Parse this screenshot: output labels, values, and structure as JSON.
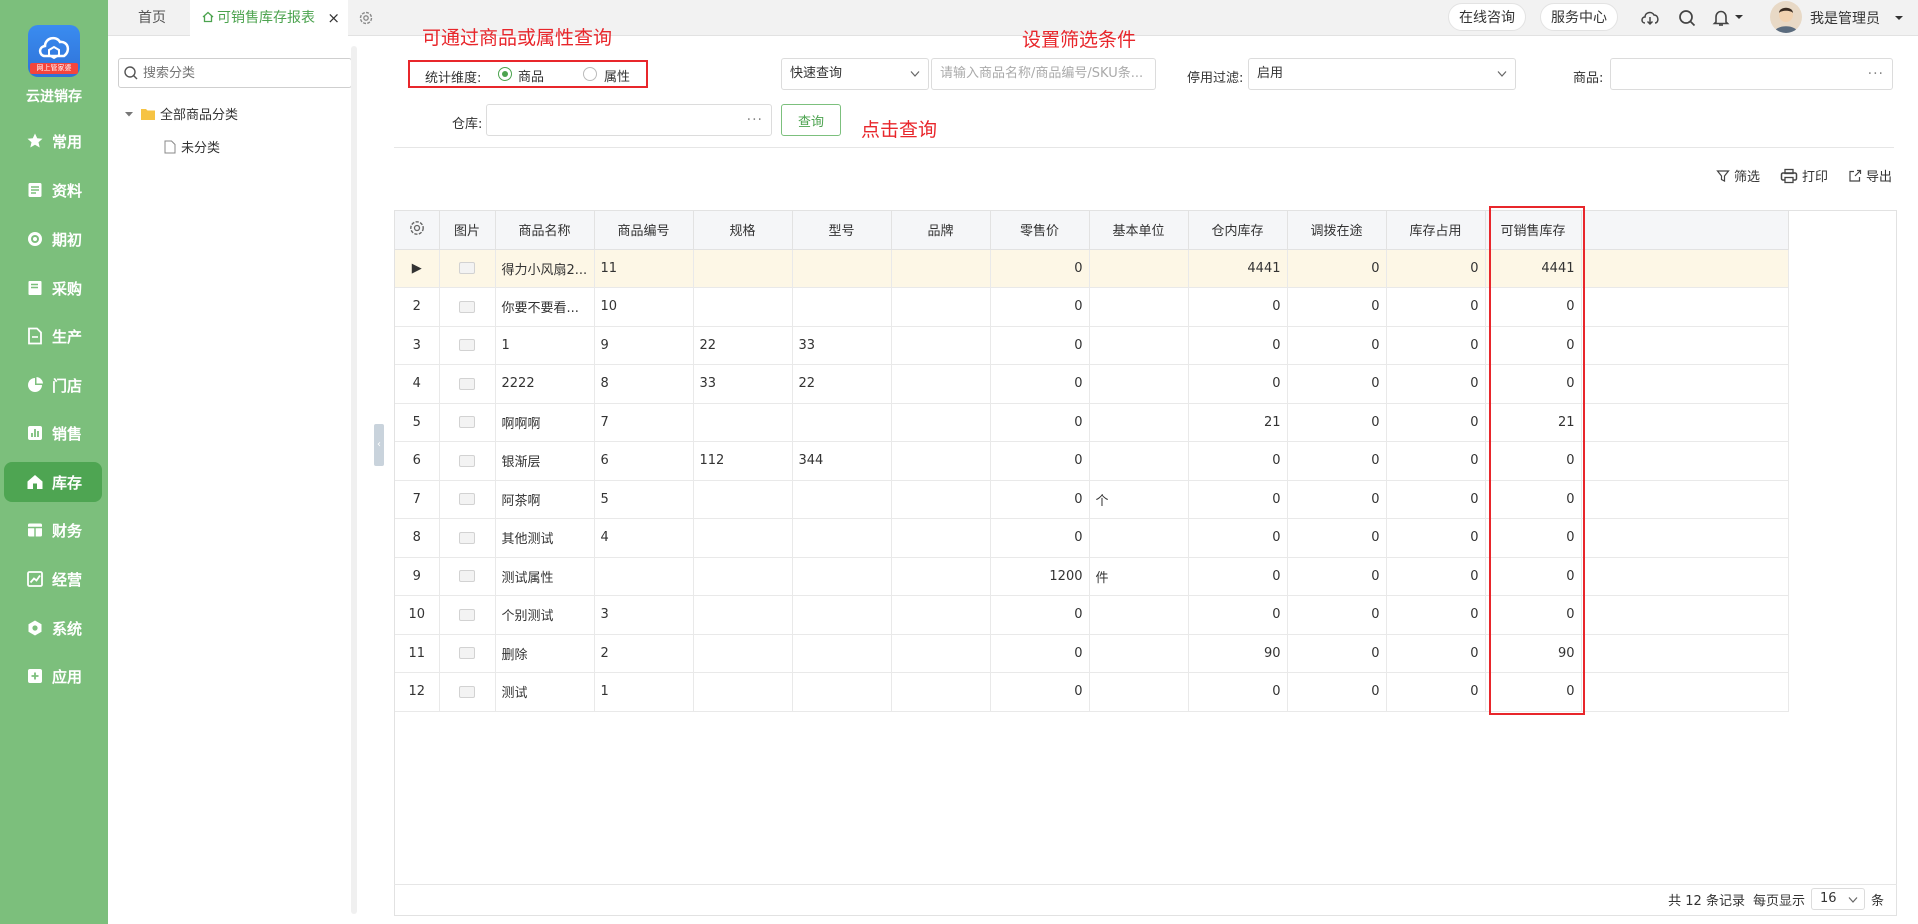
{
  "app": {
    "name": "云进销存",
    "logo_tag": "网上管家婆"
  },
  "nav": [
    {
      "label": "常用",
      "icon": "star-icon"
    },
    {
      "label": "资料",
      "icon": "document-icon"
    },
    {
      "label": "期初",
      "icon": "target-icon"
    },
    {
      "label": "采购",
      "icon": "book-icon"
    },
    {
      "label": "生产",
      "icon": "file-icon"
    },
    {
      "label": "门店",
      "icon": "pie-chart-icon"
    },
    {
      "label": "销售",
      "icon": "bar-chart-icon"
    },
    {
      "label": "库存",
      "icon": "house-icon",
      "active": true
    },
    {
      "label": "财务",
      "icon": "ledger-icon"
    },
    {
      "label": "经营",
      "icon": "trend-icon"
    },
    {
      "label": "系统",
      "icon": "hexagon-icon"
    },
    {
      "label": "应用",
      "icon": "plus-square-icon"
    }
  ],
  "tabs": {
    "home": "首页",
    "current": "可销售库存报表",
    "close": "×"
  },
  "topbar": {
    "consult": "在线咨询",
    "service": "服务中心",
    "user": "我是管理员"
  },
  "category": {
    "search_placeholder": "搜索分类",
    "root": "全部商品分类",
    "child": "未分类"
  },
  "filters": {
    "dimension_label": "统计维度:",
    "dim_product": "商品",
    "dim_attribute": "属性",
    "quick_select": "快速查询",
    "quick_placeholder": "请输入商品名称/商品编号/SKU条...",
    "disable_label": "停用过滤:",
    "disable_value": "启用",
    "product_label": "商品:",
    "warehouse_label": "仓库:",
    "query_button": "查询",
    "dots": "···"
  },
  "annotations": {
    "dimension": "可通过商品或属性查询",
    "conditions": "设置筛选条件",
    "click_query": "点击查询"
  },
  "toolbar": {
    "filter": "筛选",
    "print": "打印",
    "export": "导出"
  },
  "table": {
    "columns": [
      "图片",
      "商品名称",
      "商品编号",
      "规格",
      "型号",
      "品牌",
      "零售价",
      "基本单位",
      "仓内库存",
      "调拨在途",
      "库存占用",
      "可销售库存"
    ],
    "rows": [
      {
        "idx": "▶",
        "name": "得力小风扇2...",
        "code": "11",
        "spec": "",
        "model": "",
        "brand": "",
        "price": "0",
        "unit": "",
        "stock": "4441",
        "transit": "0",
        "occupied": "0",
        "available": "4441"
      },
      {
        "idx": "2",
        "name": "你要不要看...",
        "code": "10",
        "spec": "",
        "model": "",
        "brand": "",
        "price": "0",
        "unit": "",
        "stock": "0",
        "transit": "0",
        "occupied": "0",
        "available": "0"
      },
      {
        "idx": "3",
        "name": "1",
        "code": "9",
        "spec": "22",
        "model": "33",
        "brand": "",
        "price": "0",
        "unit": "",
        "stock": "0",
        "transit": "0",
        "occupied": "0",
        "available": "0"
      },
      {
        "idx": "4",
        "name": "2222",
        "code": "8",
        "spec": "33",
        "model": "22",
        "brand": "",
        "price": "0",
        "unit": "",
        "stock": "0",
        "transit": "0",
        "occupied": "0",
        "available": "0"
      },
      {
        "idx": "5",
        "name": "啊啊啊",
        "code": "7",
        "spec": "",
        "model": "",
        "brand": "",
        "price": "0",
        "unit": "",
        "stock": "21",
        "transit": "0",
        "occupied": "0",
        "available": "21"
      },
      {
        "idx": "6",
        "name": "银渐层",
        "code": "6",
        "spec": "112",
        "model": "344",
        "brand": "",
        "price": "0",
        "unit": "",
        "stock": "0",
        "transit": "0",
        "occupied": "0",
        "available": "0"
      },
      {
        "idx": "7",
        "name": "阿茶啊",
        "code": "5",
        "spec": "",
        "model": "",
        "brand": "",
        "price": "0",
        "unit": "个",
        "stock": "0",
        "transit": "0",
        "occupied": "0",
        "available": "0"
      },
      {
        "idx": "8",
        "name": "其他测试",
        "code": "4",
        "spec": "",
        "model": "",
        "brand": "",
        "price": "0",
        "unit": "",
        "stock": "0",
        "transit": "0",
        "occupied": "0",
        "available": "0"
      },
      {
        "idx": "9",
        "name": "测试属性",
        "code": "",
        "spec": "",
        "model": "",
        "brand": "",
        "price": "1200",
        "unit": "件",
        "stock": "0",
        "transit": "0",
        "occupied": "0",
        "available": "0"
      },
      {
        "idx": "10",
        "name": "个别测试",
        "code": "3",
        "spec": "",
        "model": "",
        "brand": "",
        "price": "0",
        "unit": "",
        "stock": "0",
        "transit": "0",
        "occupied": "0",
        "available": "0"
      },
      {
        "idx": "11",
        "name": "删除",
        "code": "2",
        "spec": "",
        "model": "",
        "brand": "",
        "price": "0",
        "unit": "",
        "stock": "90",
        "transit": "0",
        "occupied": "0",
        "available": "90"
      },
      {
        "idx": "12",
        "name": "测试",
        "code": "1",
        "spec": "",
        "model": "",
        "brand": "",
        "price": "0",
        "unit": "",
        "stock": "0",
        "transit": "0",
        "occupied": "0",
        "available": "0"
      }
    ]
  },
  "pager": {
    "total": "共 12 条记录",
    "per_page_label": "每页显示",
    "per_page": "16",
    "unit": "条"
  },
  "colors": {
    "nav_bg": "#7cbf7c",
    "nav_active": "#4ea552",
    "accent": "#4ca34f",
    "highlight": "#e8262b",
    "selected_row": "#fdf7e6"
  }
}
